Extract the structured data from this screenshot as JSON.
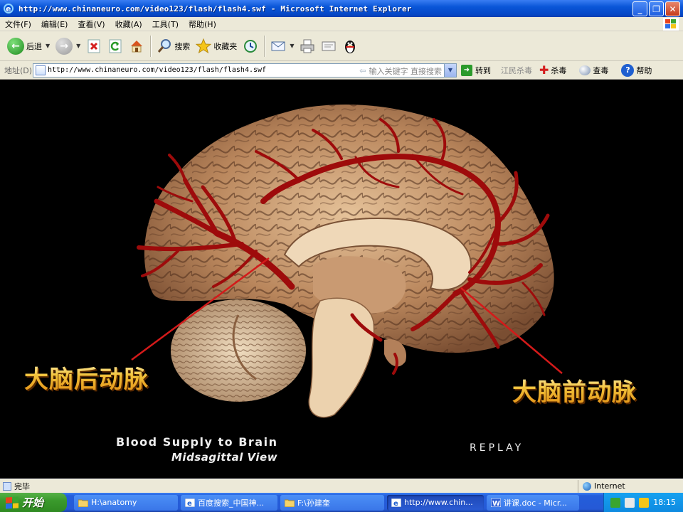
{
  "window": {
    "title": "http://www.chinaneuro.com/video123/flash/flash4.swf - Microsoft Internet Explorer",
    "buttons": [
      "_",
      "❐",
      "✕"
    ]
  },
  "menu": [
    "文件(F)",
    "编辑(E)",
    "查看(V)",
    "收藏(A)",
    "工具(T)",
    "帮助(H)"
  ],
  "toolbar": {
    "back_label": "后退",
    "search_label": "搜索",
    "favorites_label": "收藏夹"
  },
  "address": {
    "label": "地址(D)",
    "url": "http://www.chinaneuro.com/video123/flash/flash4.swf",
    "search_hint": "输入关键字 直接搜索",
    "go_label": "转到",
    "link1": "江民杀毒",
    "link2": "杀毒",
    "link3": "查毒",
    "help": "帮助"
  },
  "content": {
    "label_posterior": "大脑后动脉",
    "label_anterior": "大脑前动脉",
    "caption_title": "Blood Supply to Brain",
    "caption_view": "Midsagittal View",
    "replay": "REPLAY",
    "colors": {
      "artery": "#9e0b0b",
      "label": "#f2c23a",
      "brain": "#c9946a"
    }
  },
  "status": {
    "text": "完毕",
    "zone": "Internet"
  },
  "taskbar": {
    "start": "开始",
    "tasks": [
      {
        "label": "H:\\anatomy",
        "icon": "folder-icon"
      },
      {
        "label": "百度搜索_中国神...",
        "icon": "ie-icon"
      },
      {
        "label": "F:\\孙建奎",
        "icon": "folder-icon"
      },
      {
        "label": "http://www.chin...",
        "icon": "ie-icon"
      },
      {
        "label": "讲课.doc - Micr...",
        "icon": "word-icon"
      }
    ],
    "clock": "18:15"
  }
}
